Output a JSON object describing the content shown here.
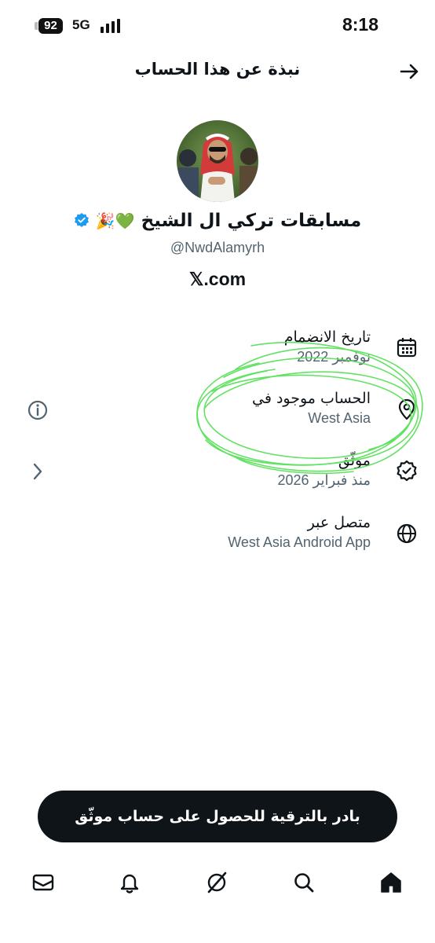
{
  "status_bar": {
    "time": "8:18",
    "battery": "92",
    "network": "5G"
  },
  "header": {
    "title": "نبذة عن هذا الحساب"
  },
  "profile": {
    "display_name": "مسابقات تركي ال الشيخ",
    "emojis": "💚🎉",
    "handle": "@NwdAlamyrh",
    "site": "𝕏.com"
  },
  "details": [
    {
      "label": "تاريخ الانضمام",
      "value": "نوفمبر 2022",
      "icon": "calendar-icon"
    },
    {
      "label": "الحساب موجود في",
      "value": "West Asia",
      "icon": "location-pin-icon"
    },
    {
      "label": "موثّق",
      "value": "منذ فبراير 2026",
      "icon": "verified-badge-icon"
    },
    {
      "label": "متصل عبر",
      "value": "West Asia Android App",
      "icon": "globe-icon"
    }
  ],
  "upgrade_button": {
    "label": "بادر بالترقية للحصول على حساب موثّق"
  },
  "tabs": [
    "mail-icon",
    "bell-icon",
    "grok-icon",
    "search-icon",
    "home-icon"
  ],
  "colors": {
    "text": "#0f1419",
    "secondary": "#536471",
    "verified_blue": "#1d9bf0",
    "annotation_green": "#5ae05a"
  }
}
